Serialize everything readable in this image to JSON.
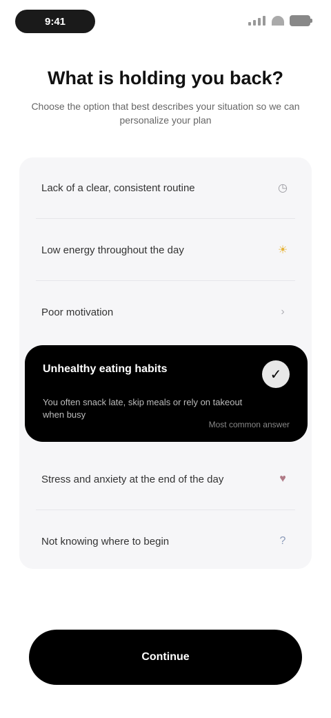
{
  "status_bar": {
    "time": "9:41"
  },
  "header": {
    "title": "What is holding you back?",
    "subtitle": "Choose the option that best describes your situation so we can personalize your plan"
  },
  "options": [
    {
      "label": "Lack of a clear, consistent routine",
      "icon": "clock-icon",
      "glyph": "◷",
      "color": "#9a9aa0"
    },
    {
      "label": "Low energy throughout the day",
      "icon": "sun-icon",
      "glyph": "☀",
      "color": "#e7b43a"
    },
    {
      "label": "Poor motivation",
      "icon": "chevron-icon",
      "glyph": "›",
      "color": "#b0b0b6"
    },
    {
      "label": "Stress and anxiety at the end of the day",
      "icon": "heart-icon",
      "glyph": "♥",
      "color": "#b07a86"
    },
    {
      "label": "Not knowing where to begin",
      "icon": "question-icon",
      "glyph": "?",
      "color": "#8a9ab8"
    }
  ],
  "selected": {
    "label": "Unhealthy eating habits",
    "description": "You often snack late, skip meals or rely on takeout when busy",
    "meta": "Most common answer",
    "check_glyph": "✓"
  },
  "primary_button": {
    "label": "Continue"
  }
}
